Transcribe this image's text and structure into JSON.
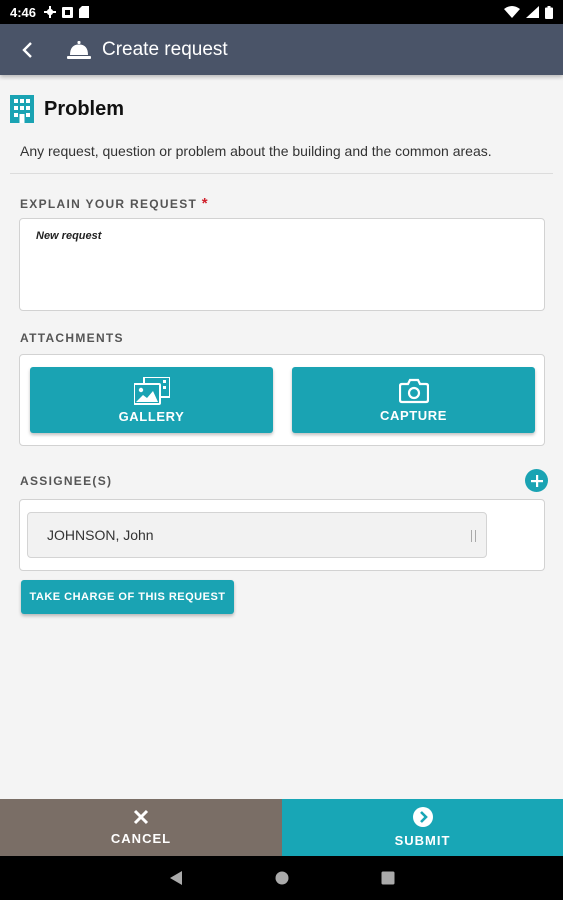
{
  "status_bar": {
    "time": "4:46"
  },
  "app_bar": {
    "title": "Create request"
  },
  "category": {
    "title": "Problem",
    "description": "Any request, question or problem about the building and the common areas."
  },
  "request_field": {
    "label": "EXPLAIN YOUR REQUEST",
    "required_mark": "*",
    "value": "New request"
  },
  "attachments": {
    "label": "ATTACHMENTS",
    "gallery_label": "GALLERY",
    "capture_label": "CAPTURE"
  },
  "assignees": {
    "label": "ASSIGNEE(S)",
    "items": [
      {
        "name": "JOHNSON, John"
      }
    ]
  },
  "take_charge_label": "TAKE CHARGE OF THIS REQUEST",
  "bottom_bar": {
    "cancel_label": "CANCEL",
    "submit_label": "SUBMIT"
  },
  "colors": {
    "accent": "#1aa3b3",
    "app_bar": "#4a5468",
    "cancel": "#7a6e66",
    "required": "#d0202b"
  }
}
